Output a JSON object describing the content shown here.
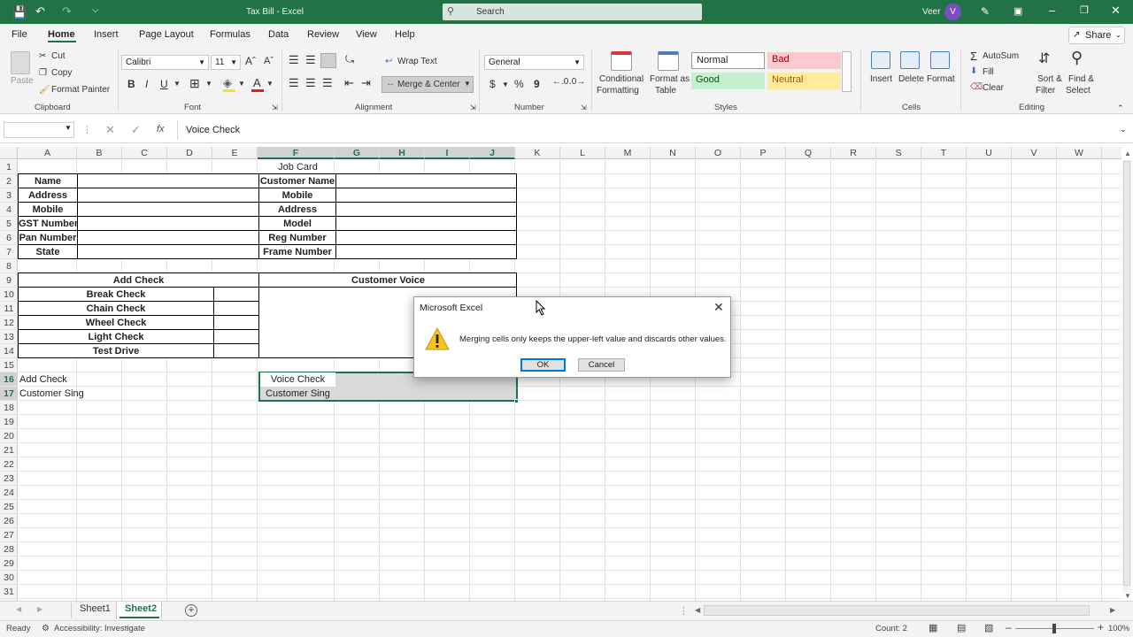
{
  "titlebar": {
    "doc_title": "Tax Bill  -  Excel",
    "search_placeholder": "Search",
    "user_name": "Veer",
    "avatar_letter": "V"
  },
  "menu": [
    "File",
    "Home",
    "Insert",
    "Page Layout",
    "Formulas",
    "Data",
    "Review",
    "View",
    "Help"
  ],
  "share_label": "Share",
  "ribbon": {
    "clipboard": {
      "paste": "Paste",
      "cut": "Cut",
      "copy": "Copy",
      "format_painter": "Format Painter",
      "group": "Clipboard"
    },
    "font": {
      "name": "Calibri",
      "size": "11",
      "bold": "B",
      "italic": "I",
      "underline": "U",
      "group": "Font"
    },
    "alignment": {
      "wrap_text": "Wrap Text",
      "merge_center": "Merge & Center",
      "group": "Alignment"
    },
    "number": {
      "format": "General",
      "currency": "$",
      "percent": "%",
      "comma": "9",
      "group": "Number"
    },
    "styles": {
      "conditional": "Conditional",
      "formatting": "Formatting",
      "format_as": "Format as",
      "table": "Table",
      "normal": "Normal",
      "bad": "Bad",
      "good": "Good",
      "neutral": "Neutral",
      "group": "Styles"
    },
    "cells": {
      "insert": "Insert",
      "delete": "Delete",
      "format": "Format",
      "group": "Cells"
    },
    "editing": {
      "autosum": "AutoSum",
      "fill": "Fill",
      "clear": "Clear",
      "sort_filter": "Sort &",
      "filter": "Filter",
      "find_select": "Find &",
      "select": "Select",
      "group": "Editing"
    }
  },
  "formula_bar": {
    "fx": "fx",
    "content": "Voice Check"
  },
  "columns": [
    "A",
    "B",
    "C",
    "D",
    "E",
    "F",
    "G",
    "H",
    "I",
    "J",
    "K",
    "L",
    "M",
    "N",
    "O",
    "P",
    "Q",
    "R",
    "S",
    "T",
    "U",
    "V",
    "W"
  ],
  "rows": [
    "1",
    "2",
    "3",
    "4",
    "5",
    "6",
    "7",
    "8",
    "9",
    "10",
    "11",
    "12",
    "13",
    "14",
    "15",
    "16",
    "17",
    "18",
    "19",
    "20",
    "21",
    "22",
    "23",
    "24",
    "25",
    "26",
    "27",
    "28",
    "29",
    "30",
    "31"
  ],
  "cells": {
    "job_card": "Job Card",
    "left_labels": [
      "Name",
      "Address",
      "Mobile",
      "GST Number",
      "Pan Number",
      "State"
    ],
    "right_labels": [
      "Customer Name",
      "Mobile",
      "Address",
      "Model",
      "Reg Number",
      "Frame Number"
    ],
    "add_check": "Add Check",
    "customer_voice": "Customer Voice",
    "checks": [
      "Break Check",
      "Chain Check",
      "Wheel Check",
      "Light Check",
      "Test Drive"
    ],
    "a16": "Add Check",
    "a17": "Customer Sing",
    "f16": "Voice Check",
    "f17": "Customer Sing"
  },
  "sheets": [
    "Sheet1",
    "Sheet2"
  ],
  "status": {
    "ready": "Ready",
    "accessibility": "Accessibility: Investigate",
    "count": "Count: 2",
    "zoom": "100%"
  },
  "dialog": {
    "title": "Microsoft Excel",
    "message": "Merging cells only keeps the upper-left value and discards other values.",
    "ok": "OK",
    "cancel": "Cancel"
  }
}
